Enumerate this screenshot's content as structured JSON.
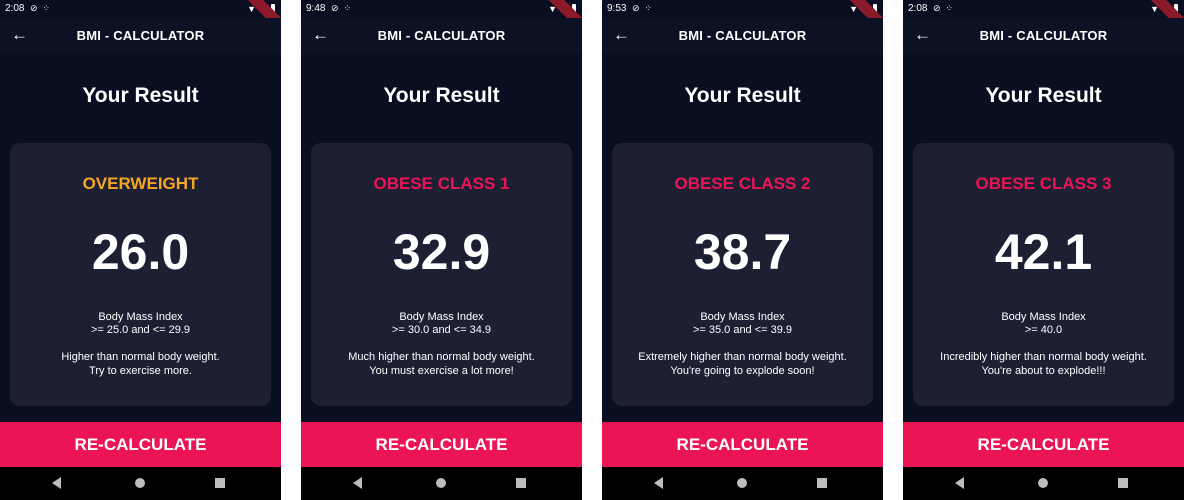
{
  "accent": "#eb1555",
  "screens": [
    {
      "status": {
        "time": "2:08"
      },
      "app_title": "BMI - CALCULATOR",
      "heading": "Your Result",
      "category": "OVERWEIGHT",
      "category_color": "#f5a623",
      "bmi": "26.0",
      "bmi_label": "Body Mass Index",
      "range": ">= 25.0 and <= 29.9",
      "advice_line1": "Higher than normal body weight.",
      "advice_line2": "Try to exercise more.",
      "button": "RE-CALCULATE"
    },
    {
      "status": {
        "time": "9:48"
      },
      "app_title": "BMI - CALCULATOR",
      "heading": "Your Result",
      "category": "OBESE CLASS 1",
      "category_color": "#eb1555",
      "bmi": "32.9",
      "bmi_label": "Body Mass Index",
      "range": ">= 30.0 and <= 34.9",
      "advice_line1": "Much higher than normal body weight.",
      "advice_line2": "You must exercise a lot more!",
      "button": "RE-CALCULATE"
    },
    {
      "status": {
        "time": "9:53"
      },
      "app_title": "BMI - CALCULATOR",
      "heading": "Your Result",
      "category": "OBESE CLASS 2",
      "category_color": "#eb1555",
      "bmi": "38.7",
      "bmi_label": "Body Mass Index",
      "range": ">= 35.0 and <= 39.9",
      "advice_line1": "Extremely higher than normal body weight.",
      "advice_line2": "You're going to explode soon!",
      "button": "RE-CALCULATE"
    },
    {
      "status": {
        "time": "2:08"
      },
      "app_title": "BMI - CALCULATOR",
      "heading": "Your Result",
      "category": "OBESE CLASS 3",
      "category_color": "#eb1555",
      "bmi": "42.1",
      "bmi_label": "Body Mass Index",
      "range": ">= 40.0",
      "advice_line1": "Incredibly higher than normal body weight.",
      "advice_line2": "You're about to explode!!!",
      "button": "RE-CALCULATE"
    }
  ]
}
